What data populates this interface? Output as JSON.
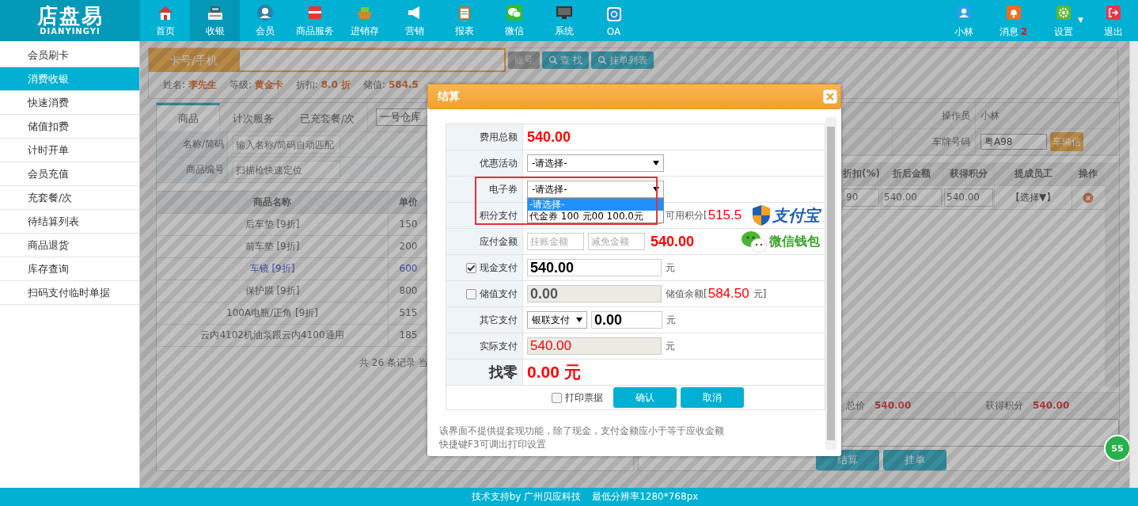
{
  "header": {
    "logo": {
      "title": "店盘易",
      "subtitle": "DIANYINGYI"
    },
    "nav": [
      {
        "label": "首页",
        "selected": false
      },
      {
        "label": "收银",
        "selected": true
      },
      {
        "label": "会员",
        "selected": false
      },
      {
        "label": "商品服务",
        "selected": false
      },
      {
        "label": "进销存",
        "selected": false
      },
      {
        "label": "营销",
        "selected": false
      },
      {
        "label": "报表",
        "selected": false
      },
      {
        "label": "微信",
        "selected": false
      },
      {
        "label": "系统",
        "selected": false
      },
      {
        "label": "OA",
        "selected": false
      }
    ],
    "user_menu": [
      {
        "label": "小林"
      },
      {
        "label": "消息",
        "badge": "2"
      },
      {
        "label": "设置",
        "caret": "▼"
      },
      {
        "label": "退出"
      }
    ]
  },
  "sidebar": {
    "items": [
      {
        "label": "会员刷卡",
        "selected": false
      },
      {
        "label": "消费收银",
        "selected": true
      },
      {
        "label": "快速消费",
        "selected": false
      },
      {
        "label": "储值扣费",
        "selected": false
      },
      {
        "label": "计时开单",
        "selected": false
      },
      {
        "label": "会员充值",
        "selected": false
      },
      {
        "label": "充套餐/次",
        "selected": false
      },
      {
        "label": "待结算列表",
        "selected": false
      },
      {
        "label": "商品退货",
        "selected": false
      },
      {
        "label": "库存查询",
        "selected": false
      },
      {
        "label": "扫码支付临时单据",
        "selected": false
      }
    ]
  },
  "member_bar": {
    "card_label": "卡号/手机",
    "buttons": [
      {
        "label": "账号",
        "disabled": true
      },
      {
        "label": "查 找",
        "disabled": false
      },
      {
        "label": "挂单列表",
        "disabled": false
      }
    ],
    "info": [
      {
        "label": "姓名:",
        "value": "李先生"
      },
      {
        "label": "等级:",
        "value": "黄金卡"
      },
      {
        "label": "折扣:",
        "value": "8.0 折"
      },
      {
        "label": "储值:",
        "value": "584.5"
      }
    ]
  },
  "goods_panel": {
    "tabs": [
      {
        "label": "商品",
        "selected": true
      },
      {
        "label": "计次服务",
        "selected": false
      },
      {
        "label": "已充套餐/次",
        "selected": false
      }
    ],
    "warehouse": "一号仓库",
    "search_fields": [
      {
        "label": "名称/简码",
        "placeholder": "输入名称/简码自动匹配"
      },
      {
        "label": "商品编号",
        "placeholder": "扫描枪快速定位"
      }
    ],
    "table": {
      "columns": [
        "商品名称",
        "单价"
      ],
      "rows": [
        {
          "name": "后车垫",
          "discount": "[9折]",
          "price": "150",
          "selected": false
        },
        {
          "name": "前车垫",
          "discount": "[9折]",
          "price": "200",
          "selected": false
        },
        {
          "name": "车镜",
          "discount": "[9折]",
          "price": "600",
          "selected": true
        },
        {
          "name": "保护膜",
          "discount": "[9折]",
          "price": "800",
          "selected": false
        },
        {
          "name": "100A电瓶/正角",
          "discount": "[9折]",
          "price": "515",
          "selected": false
        },
        {
          "name": "云内4102机油泵跟云内4100通用",
          "price": "185",
          "selected": false
        }
      ]
    },
    "pagination": "共 26 条记录 当"
  },
  "order_panel": {
    "operator": {
      "label": "操作员",
      "value": "小林"
    },
    "plate": {
      "label": "车牌号码",
      "value": "粤A98",
      "button": "车辆信"
    },
    "table": {
      "columns": [
        "折扣(%)",
        "折后金额",
        "获得积分",
        "提成员工",
        "操作"
      ],
      "rows": [
        {
          "discount": "90",
          "amount": "540.00",
          "points": "540.00",
          "staff": "【选择▼】"
        }
      ]
    },
    "summary": [
      {
        "label": "总价",
        "value": "540.00"
      },
      {
        "label": "获得积分",
        "value": "540.00"
      }
    ],
    "buttons": [
      "结算",
      "挂单"
    ]
  },
  "float_badge": "55",
  "footer": [
    "技术支持by 广州贝应科技",
    "最低分辨率1280*768px"
  ],
  "dialog": {
    "title": "结算",
    "rows": [
      {
        "kind": "amount",
        "label": "费用总额",
        "value": "540.00"
      },
      {
        "kind": "select",
        "label": "优惠活动",
        "value": "-请选择-"
      },
      {
        "kind": "select",
        "label": "电子券",
        "value": "-请选择-",
        "highlighted": true,
        "expanded": true,
        "options": [
          {
            "label": "-请选择-",
            "selected": true
          },
          {
            "label": "代金券 100 元00 100.0元",
            "selected": false
          }
        ]
      },
      {
        "kind": "points",
        "label": "积分支付",
        "note": "可用积分[",
        "balance": "515.5"
      },
      {
        "kind": "payable",
        "label": "应付金额",
        "placeholders": [
          "挂账金额",
          "减免金额"
        ],
        "value": "540.00"
      },
      {
        "kind": "check",
        "label": "现金支付",
        "checked": true,
        "disabled": false,
        "value": "540.00",
        "unit": "元"
      },
      {
        "kind": "check",
        "label": "储值支付",
        "checked": false,
        "disabled": true,
        "value": "0.00",
        "note": "储值余额[",
        "balance": "584.50",
        "unit": "元]"
      },
      {
        "kind": "other",
        "label": "其它支付",
        "method": "银联支付",
        "value": "0.00",
        "unit": "元"
      },
      {
        "kind": "readonly",
        "label": "实际支付",
        "value": "540.00",
        "unit": "元"
      },
      {
        "kind": "change",
        "label": "找零",
        "value": "0.00 元"
      }
    ],
    "payment_logos": [
      "支付宝",
      "微信钱包"
    ],
    "print_receipt": {
      "label": "打印票据",
      "checked": false
    },
    "buttons": [
      "确认",
      "取消"
    ],
    "notes": [
      "该界面不提供提套现功能，除了现金，支付金额应小于等于应收金额",
      "快捷键F3可调出打印设置"
    ]
  }
}
